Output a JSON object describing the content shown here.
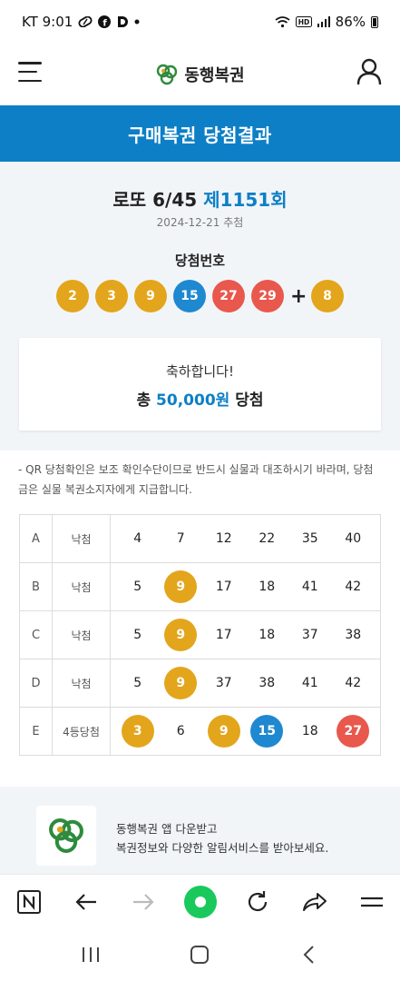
{
  "status_bar": {
    "carrier_time": "KT 9:01",
    "icons_left": [
      "pill-icon",
      "facebook-icon",
      "d-app-icon",
      "dot-icon"
    ],
    "icons_right": [
      "wifi-icon",
      "hd-icon",
      "signal-icon"
    ],
    "battery": "86%"
  },
  "header": {
    "logo_text": "동행복권",
    "brand_color": "#2e8b3d"
  },
  "page_title": "구매복권 당첨결과",
  "draw": {
    "game": "로또 6/45",
    "round": "제1151회",
    "date": "2024-12-21 추첨",
    "winning_label": "당첨번호",
    "numbers": [
      {
        "value": "2",
        "color": "yellow"
      },
      {
        "value": "3",
        "color": "yellow"
      },
      {
        "value": "9",
        "color": "yellow"
      },
      {
        "value": "15",
        "color": "blue"
      },
      {
        "value": "27",
        "color": "red"
      },
      {
        "value": "29",
        "color": "red"
      }
    ],
    "plus": "+",
    "bonus": {
      "value": "8",
      "color": "yellow"
    }
  },
  "result": {
    "congrats": "축하합니다!",
    "prefix": "총",
    "amount": "50,000원",
    "suffix": "당첨"
  },
  "notice": "- QR 당첨확인은 보조 확인수단이므로 반드시 실물과 대조하시기 바라며, 당첨금은 실물 복권소지자에게 지급합니다.",
  "tickets": [
    {
      "game": "A",
      "result": "낙첨",
      "numbers": [
        {
          "v": "4",
          "hit": ""
        },
        {
          "v": "7",
          "hit": ""
        },
        {
          "v": "12",
          "hit": ""
        },
        {
          "v": "22",
          "hit": ""
        },
        {
          "v": "35",
          "hit": ""
        },
        {
          "v": "40",
          "hit": ""
        }
      ]
    },
    {
      "game": "B",
      "result": "낙첨",
      "numbers": [
        {
          "v": "5",
          "hit": ""
        },
        {
          "v": "9",
          "hit": "yellow"
        },
        {
          "v": "17",
          "hit": ""
        },
        {
          "v": "18",
          "hit": ""
        },
        {
          "v": "41",
          "hit": ""
        },
        {
          "v": "42",
          "hit": ""
        }
      ]
    },
    {
      "game": "C",
      "result": "낙첨",
      "numbers": [
        {
          "v": "5",
          "hit": ""
        },
        {
          "v": "9",
          "hit": "yellow"
        },
        {
          "v": "17",
          "hit": ""
        },
        {
          "v": "18",
          "hit": ""
        },
        {
          "v": "37",
          "hit": ""
        },
        {
          "v": "38",
          "hit": ""
        }
      ]
    },
    {
      "game": "D",
      "result": "낙첨",
      "numbers": [
        {
          "v": "5",
          "hit": ""
        },
        {
          "v": "9",
          "hit": "yellow"
        },
        {
          "v": "37",
          "hit": ""
        },
        {
          "v": "38",
          "hit": ""
        },
        {
          "v": "41",
          "hit": ""
        },
        {
          "v": "42",
          "hit": ""
        }
      ]
    },
    {
      "game": "E",
      "result": "4등당첨",
      "numbers": [
        {
          "v": "3",
          "hit": "yellow"
        },
        {
          "v": "6",
          "hit": ""
        },
        {
          "v": "9",
          "hit": "yellow"
        },
        {
          "v": "15",
          "hit": "blue"
        },
        {
          "v": "18",
          "hit": ""
        },
        {
          "v": "27",
          "hit": "red"
        }
      ]
    }
  ],
  "ball_colors": {
    "yellow": "#e3a51c",
    "blue": "#1e88d0",
    "red": "#e8584d"
  },
  "promo": {
    "line1": "동행복권 앱 다운받고",
    "line2": "복권정보와 다양한 알림서비스를 받아보세요."
  },
  "browser_toolbar": [
    "naver-n-icon",
    "back-arrow-icon",
    "forward-arrow-icon",
    "home-icon",
    "refresh-icon",
    "share-icon",
    "menu-icon"
  ],
  "system_nav": [
    "recent-apps-icon",
    "home-icon",
    "back-icon"
  ]
}
